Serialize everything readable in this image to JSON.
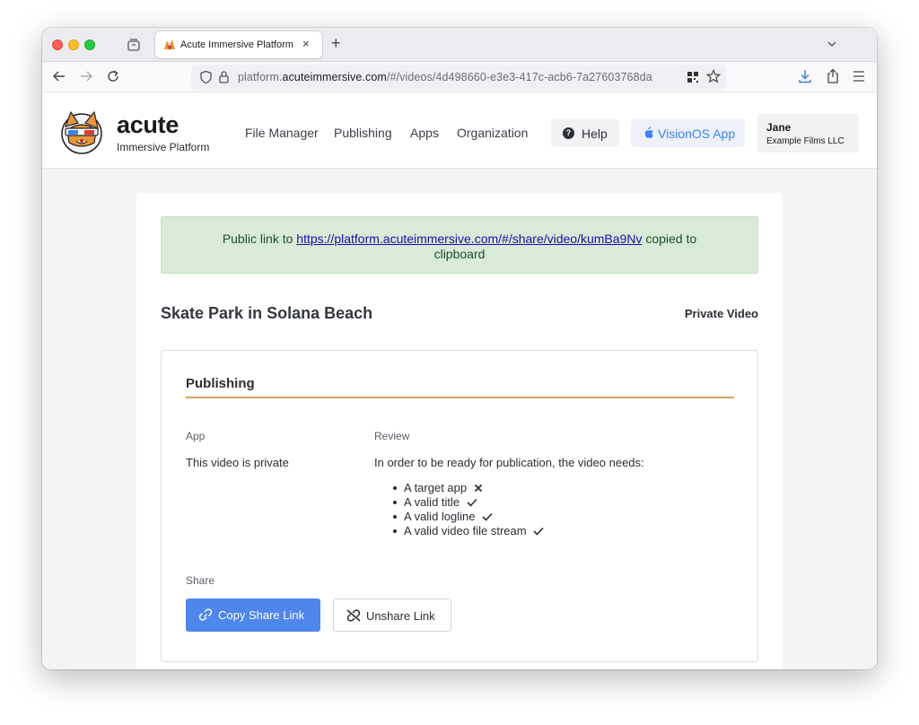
{
  "browser": {
    "tab_title": "Acute Immersive Platform",
    "new_tab": "+",
    "tab_close": "×",
    "url_prefix": "platform.",
    "url_domain": "acuteimmersive.com",
    "url_path": "/#/videos/4d498660-e3e3-417c-acb6-7a27603768da"
  },
  "header": {
    "brand_name": "acute",
    "brand_sub": "Immersive Platform",
    "nav": [
      "File Manager",
      "Publishing",
      "Apps",
      "Organization"
    ],
    "help_label": "Help",
    "vision_label": "VisionOS App",
    "user_name": "Jane",
    "user_org": "Example Films LLC"
  },
  "alert": {
    "prefix": "Public link to ",
    "link": "https://platform.acuteimmersive.com/#/share/video/kumBa9Nv",
    "suffix": " copied to clipboard"
  },
  "video": {
    "title": "Skate Park in Solana Beach",
    "visibility": "Private Video"
  },
  "publishing": {
    "title": "Publishing",
    "app_label": "App",
    "app_value": "This video is private",
    "review_label": "Review",
    "review_text": "In order to be ready for publication, the video needs:",
    "requirements": [
      {
        "label": "A target app",
        "ok": false
      },
      {
        "label": "A valid title",
        "ok": true
      },
      {
        "label": "A valid logline",
        "ok": true
      },
      {
        "label": "A valid video file stream",
        "ok": true
      }
    ],
    "share_label": "Share",
    "copy_button": "Copy Share Link",
    "unshare_button": "Unshare Link"
  },
  "colors": {
    "accent_blue": "#4f86ec",
    "alert_bg": "#d8ebd7",
    "rule_gold": "#d1a760"
  }
}
